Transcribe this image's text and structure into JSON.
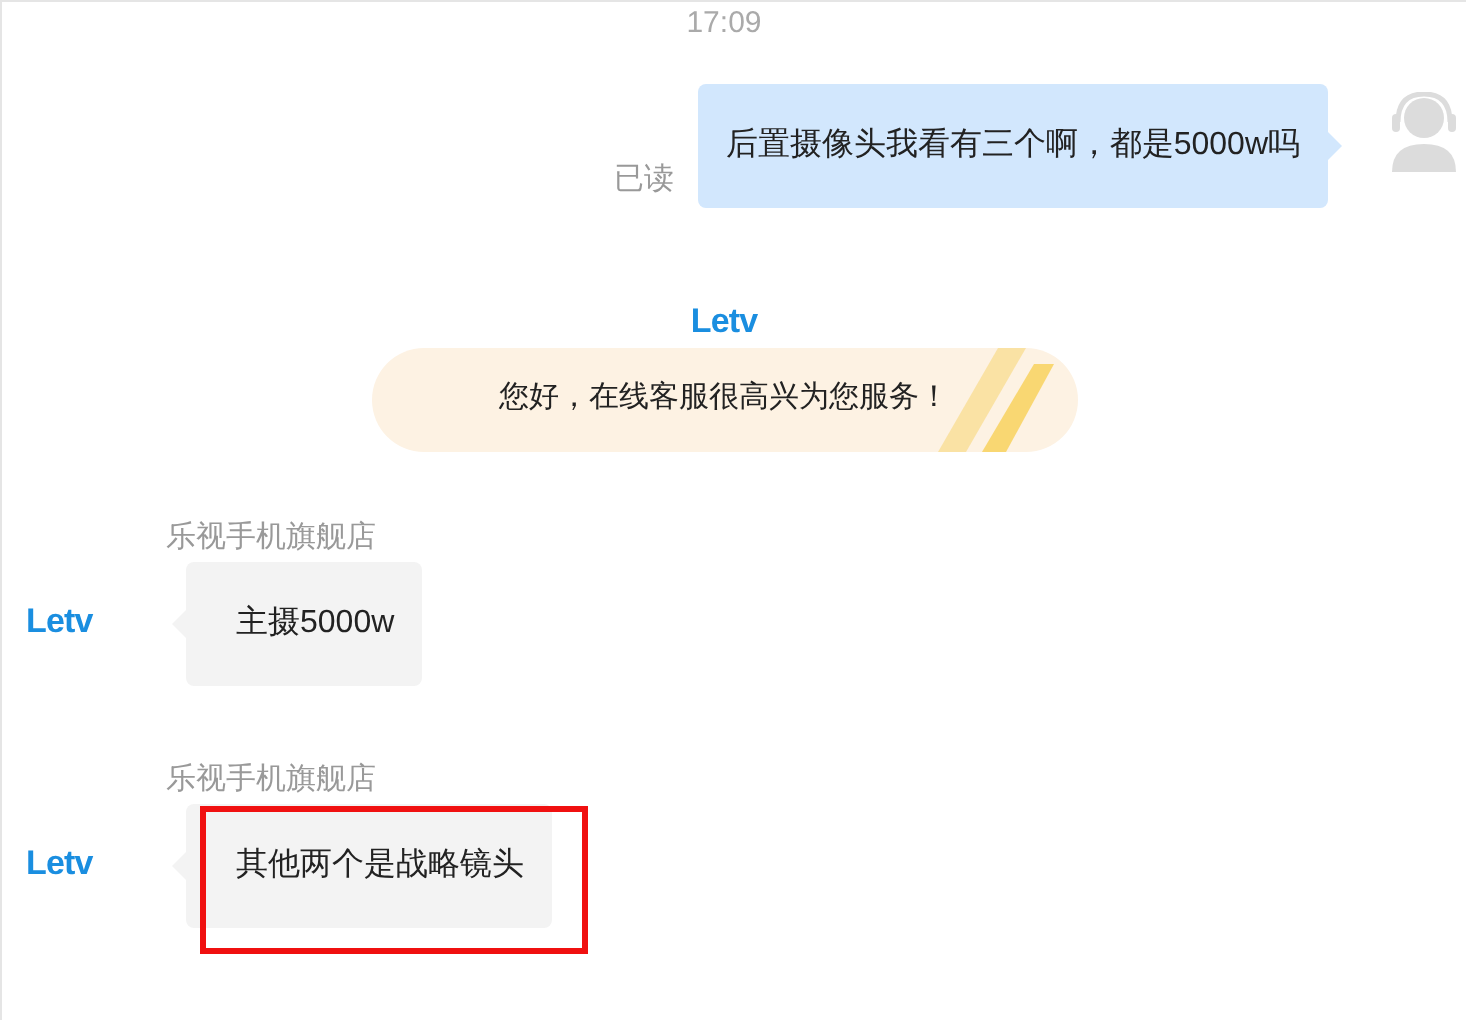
{
  "time": "17:09",
  "messages": [
    {
      "kind": "outgoing",
      "text": "后置摄像头我看有三个啊，都是5000w吗",
      "status": "已读"
    },
    {
      "kind": "greeting",
      "logo": "Letv",
      "text": "您好，在线客服很高兴为您服务！"
    },
    {
      "kind": "incoming",
      "sender": "乐视手机旗舰店",
      "logo": "Letv",
      "text": "主摄5000w",
      "highlighted": false
    },
    {
      "kind": "incoming",
      "sender": "乐视手机旗舰店",
      "logo": "Letv",
      "text": "其他两个是战略镜头",
      "highlighted": true
    }
  ]
}
